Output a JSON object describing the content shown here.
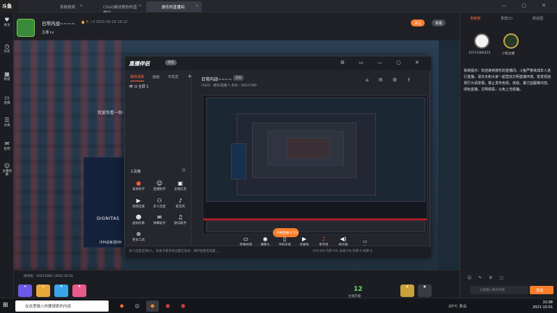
{
  "browser": {
    "logo": "斗鱼",
    "tabs": [
      {
        "label": "系统视频",
        "active": false
      },
      {
        "label": "CSGO解说教你的直播间",
        "active": false
      },
      {
        "label": "游乐的直播间",
        "active": true
      }
    ],
    "window_controls": "— ▢ ✕"
  },
  "rail": {
    "items": [
      {
        "label": "关注",
        "icon": "heart-icon"
      },
      {
        "label": "历史",
        "icon": "clock-icon"
      },
      {
        "label": "频道",
        "icon": "grid-icon"
      },
      {
        "label": "直播",
        "icon": "tv-icon"
      },
      {
        "label": "分类",
        "icon": "list-icon"
      },
      {
        "label": "鱼吧",
        "icon": "chat-icon"
      },
      {
        "label": "主播招募",
        "icon": "person-icon"
      }
    ]
  },
  "room": {
    "title": "日常内战~~~~",
    "meta": "🔥 6  ☆0  2021-09-29 19:12",
    "sub": "主播  Lv",
    "number": "房间号：10237280  |  2021.10.01",
    "follow_label": "关注",
    "report_label": "举报",
    "fish_count": "12",
    "fish_label": "主播开播"
  },
  "app": {
    "logo": "直播伴侣",
    "version": "体验",
    "tabs": {
      "left_tabs": [
        "我的场景",
        "画面",
        "可发送"
      ]
    },
    "scene_label": "全屏 1",
    "tools_title": "工具箱",
    "tools": [
      {
        "label": "录屏助手",
        "icon": "record-icon"
      },
      {
        "label": "直播助手",
        "icon": "person-icon"
      },
      {
        "label": "主播信息",
        "icon": "id-icon"
      },
      {
        "label": "视频连麦",
        "icon": "video-icon"
      },
      {
        "label": "多人连麦",
        "icon": "people-icon"
      },
      {
        "label": "麦克风",
        "icon": "mic-icon"
      },
      {
        "label": "虚拟形象",
        "icon": "face-icon"
      },
      {
        "label": "弹幕助手",
        "icon": "danmaku-icon"
      },
      {
        "label": "歌词助手",
        "icon": "music-icon"
      },
      {
        "label": "更多工具",
        "icon": "plus-icon"
      }
    ],
    "stream_title": "日常内战~~~~",
    "stream_tag": "竞技",
    "stream_info": "CSGO · 解说/直播 ✎   房号 · 10237280",
    "bottom_controls": [
      {
        "label": "直播画面",
        "icon": "screen-icon"
      },
      {
        "label": "摄像头",
        "icon": "camera-icon"
      },
      {
        "label": "手机投屏",
        "icon": "phone-icon"
      },
      {
        "label": "多媒体",
        "icon": "media-icon"
      },
      {
        "label": "麦克风",
        "icon": "mic-icon"
      },
      {
        "label": "扬声器",
        "icon": "speaker-icon"
      }
    ],
    "go_live": "开始直播 (F11)",
    "status": "多人连麦支持6人，有关于麦开关设置在房间：请开放麦克风麦，…",
    "bitrate": "CPU:0%  内存:0%  丢帧:0%  码率:0  帧率:0"
  },
  "ghost": {
    "welcome": "我爱你看一眼~~~",
    "card_label": "DIGNITAS",
    "card_name": "IEM战争遗RM"
  },
  "panel": {
    "tabs": [
      "贡献榜",
      "贵宾(1)",
      "粉丝团"
    ],
    "users": [
      {
        "name": "10711485422"
      },
      {
        "name": "小程主播"
      }
    ],
    "system_message": "系统提示：欢迎来到游乐的直播间。斗鱼严禁未成年人进行直播，请天天和大家一起营造文明直播环境。若发现违规行为请举报，禁止发布色情、低俗、暴力血腥等内容。绿色直播，文明观看，以免上当受骗。",
    "input_placeholder": "这里输入聊天内容",
    "send_label": "发送"
  },
  "taskbar": {
    "search_placeholder": "在这里输入你要搜索的内容",
    "weather": "20°C  多云",
    "time": "22:08",
    "date": "2021-10-01"
  },
  "colors": {
    "accent": "#ff7e2a",
    "bg": "#1b1c22"
  }
}
